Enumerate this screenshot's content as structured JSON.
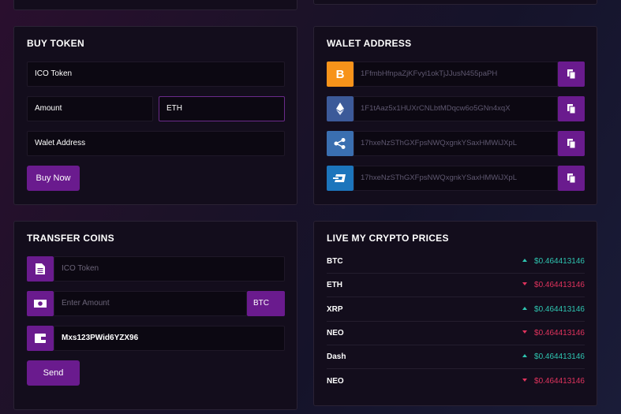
{
  "buy_token": {
    "title": "BUY TOKEN",
    "token_field": "ICO Token",
    "amount_field": "Amount",
    "currency_field": "ETH",
    "wallet_field": "Walet Address",
    "buy_button": "Buy Now"
  },
  "wallet_address": {
    "title": "WALET ADDRESS",
    "rows": [
      {
        "coin": "bitcoin-icon",
        "color": "#f7931a",
        "address": "1FfmbHfnpaZjKFvyi1okTjJJusN455paPH"
      },
      {
        "coin": "ethereum-icon",
        "color": "#3c5a99",
        "address": "1F1tAaz5x1HUXrCNLbtMDqcw6o5GNn4xqX"
      },
      {
        "coin": "ripple-icon",
        "color": "#3a6fb0",
        "address": "17hxeNzSThGXFpsNWQxgnkYSaxHMWiJXpL"
      },
      {
        "coin": "dash-icon",
        "color": "#1c75bc",
        "address": "17hxeNzSThGXFpsNWQxgnkYSaxHMWiJXpL"
      }
    ]
  },
  "transfer_coins": {
    "title": "TRANSFER COINS",
    "token_placeholder": "ICO Token",
    "amount_placeholder": "Enter Amount",
    "currency": "BTC",
    "wallet_value": "Mxs123PWid6YZX96",
    "send_button": "Send"
  },
  "live_prices": {
    "title": "LIVE MY CRYPTO PRICES",
    "rows": [
      {
        "symbol": "BTC",
        "direction": "up",
        "value": "$0.464413146"
      },
      {
        "symbol": "ETH",
        "direction": "down",
        "value": "$0.464413146"
      },
      {
        "symbol": "XRP",
        "direction": "up",
        "value": "$0.464413146"
      },
      {
        "symbol": "NEO",
        "direction": "down",
        "value": "$0.464413146"
      },
      {
        "symbol": "Dash",
        "direction": "up",
        "value": "$0.464413146"
      },
      {
        "symbol": "NEO",
        "direction": "down",
        "value": "$0.464413146"
      }
    ]
  },
  "colors": {
    "accent": "#6a1b8e",
    "up": "#2ec4b0",
    "down": "#e0335d"
  }
}
